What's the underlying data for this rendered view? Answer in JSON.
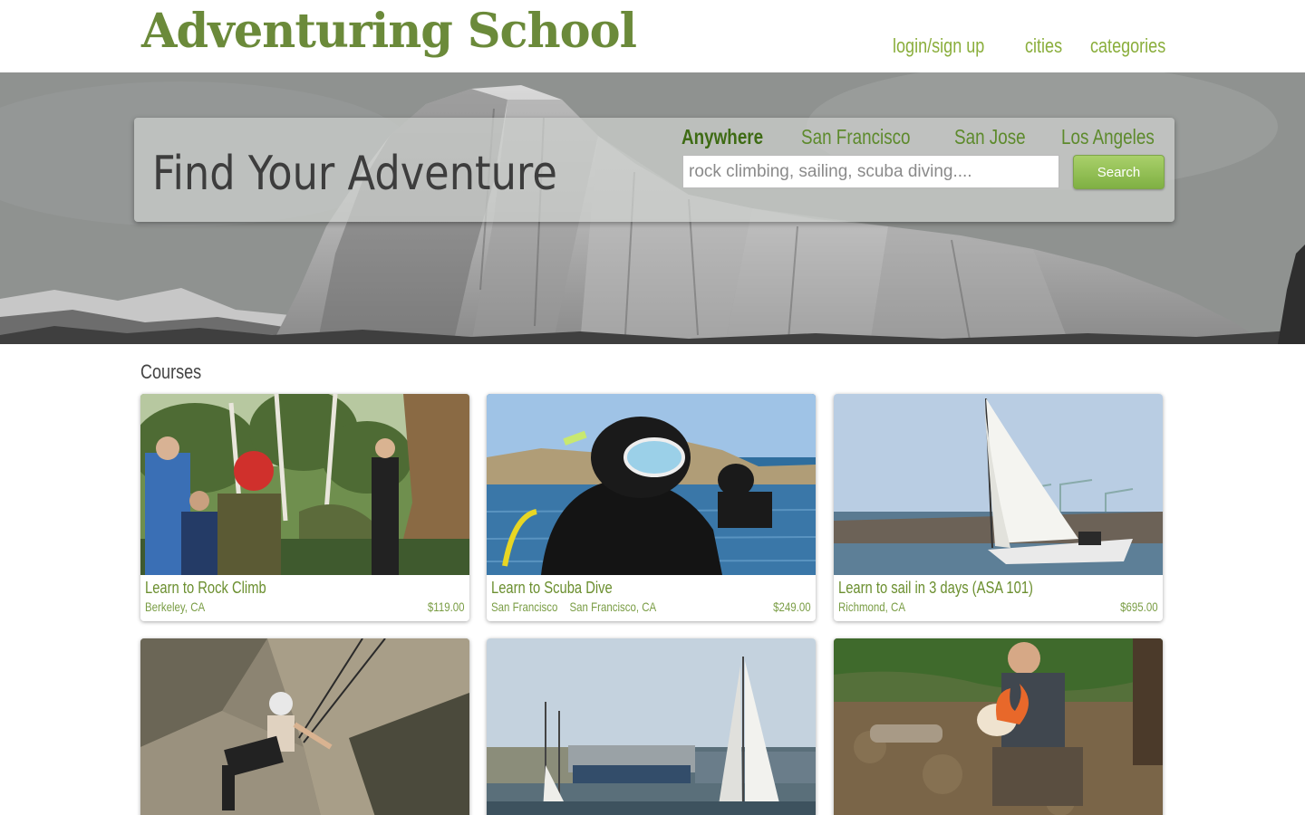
{
  "header": {
    "logo": "Adventuring School",
    "nav": {
      "login": "login/sign up",
      "cities": "cities",
      "categories": "categories"
    }
  },
  "hero": {
    "title": "Find Your Adventure",
    "cities": [
      "Anywhere",
      "San Francisco",
      "San Jose",
      "Los Angeles"
    ],
    "active_city": "Anywhere",
    "search_placeholder": "rock climbing, sailing, scuba diving....",
    "search_button": "Search"
  },
  "courses": {
    "heading": "Courses",
    "items": [
      {
        "title": "Learn to Rock Climb",
        "locations": [
          "Berkeley, CA"
        ],
        "price": "$119.00",
        "photo": "rock-climbing-photo"
      },
      {
        "title": "Learn to Scuba Dive",
        "locations": [
          "San Francisco",
          "San Francisco, CA"
        ],
        "price": "$249.00",
        "photo": "scuba-diving-photo"
      },
      {
        "title": "Learn to sail in 3 days (ASA 101)",
        "locations": [
          "Richmond, CA"
        ],
        "price": "$695.00",
        "photo": "sailing-photo"
      },
      {
        "title": "",
        "locations": [],
        "price": "",
        "photo": "climber-on-rock-photo"
      },
      {
        "title": "",
        "locations": [],
        "price": "",
        "photo": "marina-sailboat-photo"
      },
      {
        "title": "",
        "locations": [],
        "price": "",
        "photo": "fire-starting-photo"
      }
    ]
  },
  "colors": {
    "brand_green": "#6b8a3a",
    "nav_green": "#8aae3c",
    "button_green": "#8fbd4f"
  }
}
